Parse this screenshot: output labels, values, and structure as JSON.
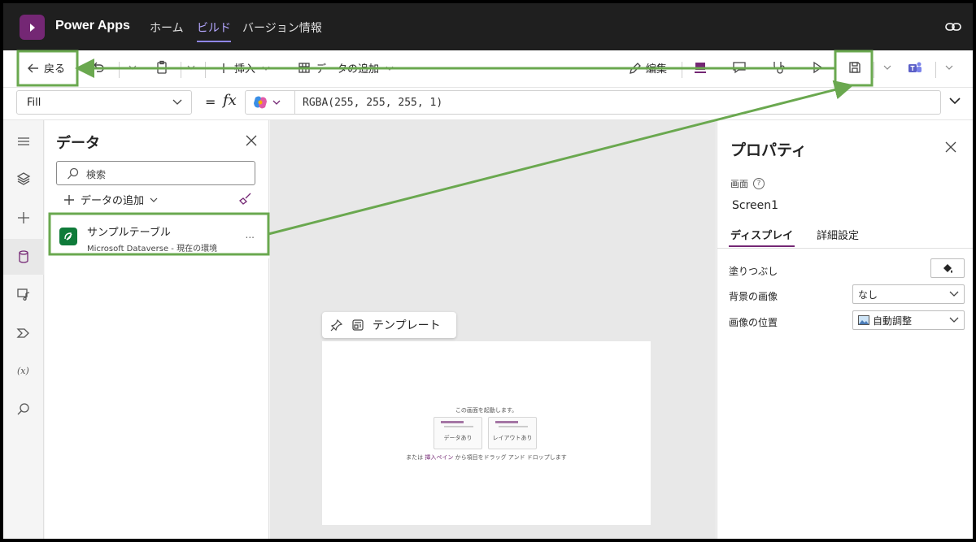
{
  "topbar": {
    "app_name": "Power Apps",
    "tabs": [
      {
        "label": "ホーム"
      },
      {
        "label": "ビルド"
      },
      {
        "label": "バージョン情報"
      }
    ]
  },
  "toolbar": {
    "back_label": "戻る",
    "insert_label": "挿入",
    "add_data_label": "データの追加",
    "edit_label": "編集"
  },
  "formula": {
    "property": "Fill",
    "eq": "=",
    "fx": "fx",
    "value": "RGBA(255, 255, 255, 1)"
  },
  "data_pane": {
    "title": "データ",
    "search_placeholder": "検索",
    "add_data_label": "データの追加",
    "items": [
      {
        "name": "サンプルテーブル",
        "source": "Microsoft Dataverse - 現在の環境",
        "more": "..."
      }
    ]
  },
  "canvas": {
    "template_label": "テンプレート",
    "hint": "この画面を起動します。",
    "option_with_data": "データあり",
    "option_layout": "レイアウトあり",
    "footer_prefix": "または",
    "footer_link": "挿入ペイン",
    "footer_suffix": "から項目をドラッグ アンド ドロップします"
  },
  "props_pane": {
    "title": "プロパティ",
    "type_label": "画面",
    "screen_name": "Screen1",
    "tab_display": "ディスプレイ",
    "tab_advanced": "詳細設定",
    "fill_label": "塗りつぶし",
    "bg_image_label": "背景の画像",
    "bg_image_value": "なし",
    "image_position_label": "画像の位置",
    "image_position_value": "自動調整"
  },
  "colors": {
    "brand": "#742774",
    "annotation": "#6aa84f",
    "topbar": "#1f1f1f",
    "active_tab": "#b4a7ff"
  }
}
